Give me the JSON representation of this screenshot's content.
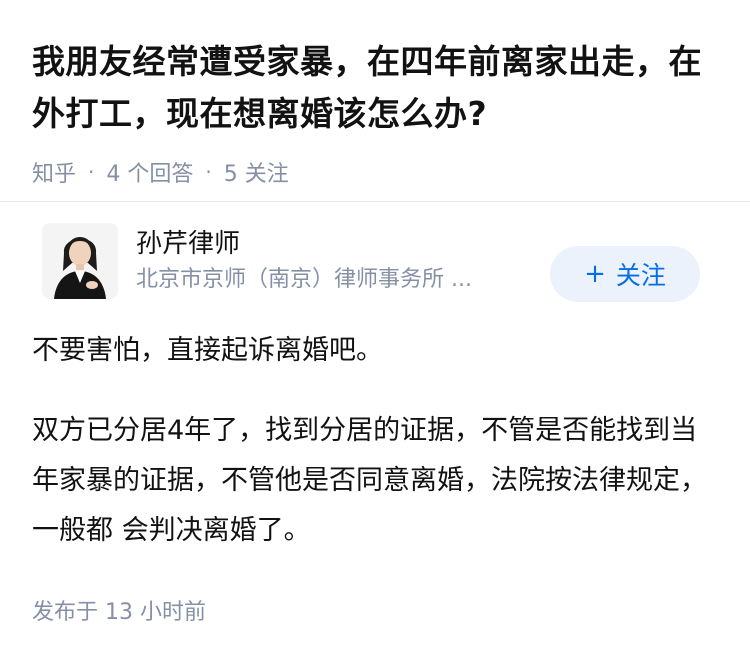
{
  "question": {
    "title": "我朋友经常遭受家暴，在四年前离家出走，在外打工，现在想离婚该怎么办?",
    "source": "知乎",
    "answers_count": "4 个回答",
    "followers_count": "5 关注"
  },
  "answer": {
    "author_name": "孙芹律师",
    "author_org": "北京市京师（南京）律师事务所 ...",
    "follow_label": "关注",
    "follow_icon": "plus-icon",
    "paragraphs": [
      "不要害怕，直接起诉离婚吧。",
      "双方已分居4年了，找到分居的证据，不管是否能找到当年家暴的证据，不管他是否同意离婚，法院按法律规定，一般都 会判决离婚了。"
    ],
    "published": "发布于 13 小时前"
  },
  "colors": {
    "accent": "#056de8",
    "follow_bg": "#ebf2fc",
    "meta_text": "#8590a6"
  }
}
